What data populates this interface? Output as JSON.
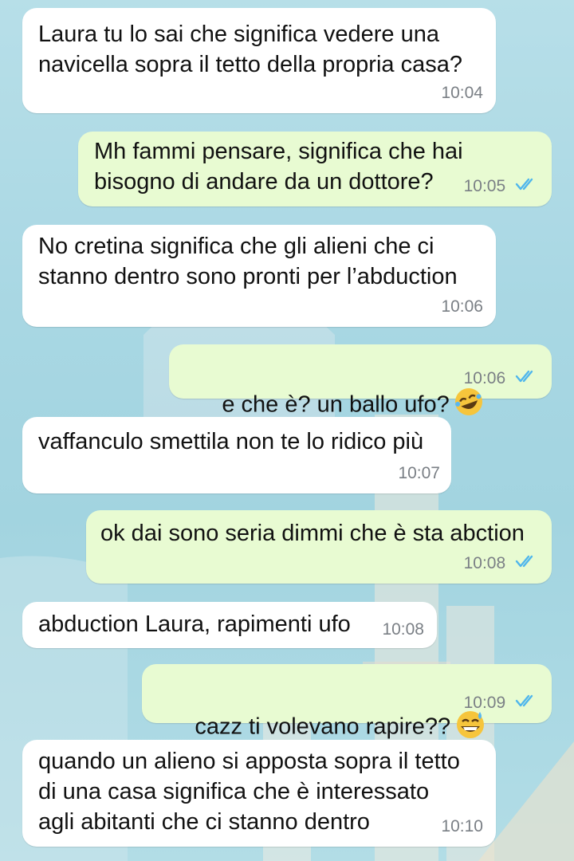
{
  "messages": [
    {
      "direction": "incoming",
      "text": "Laura tu lo sai che significa vedere una\nnavicella sopra il tetto della propria casa?",
      "time": "10:04"
    },
    {
      "direction": "outgoing",
      "text": "Mh fammi pensare, significa che hai\nbisogno di andare da un dottore?",
      "time": "10:05",
      "status": "read"
    },
    {
      "direction": "incoming",
      "text": "No cretina significa che gli alieni che ci\nstanno dentro sono pronti per l’abduction",
      "time": "10:06"
    },
    {
      "direction": "outgoing",
      "text": "e che è? un ballo ufo?",
      "emoji": "rolling-on-floor-laughing-emoji",
      "time": "10:06",
      "status": "read"
    },
    {
      "direction": "incoming",
      "text": "vaffanculo smettila non te lo ridico più",
      "time": "10:07"
    },
    {
      "direction": "outgoing",
      "text": "ok dai sono seria dimmi che è sta abction",
      "time": "10:08",
      "status": "read"
    },
    {
      "direction": "incoming",
      "text": "abduction Laura, rapimenti ufo",
      "time": "10:08"
    },
    {
      "direction": "outgoing",
      "text": "cazz ti volevano rapire??",
      "emoji": "grinning-sweat-emoji",
      "time": "10:09",
      "status": "read"
    },
    {
      "direction": "incoming",
      "text": "quando un alieno si apposta sopra il tetto\ndi una casa significa che è interessato\nagli abitanti che ci stanno dentro",
      "time": "10:10"
    }
  ],
  "colors": {
    "incoming": "#ffffff",
    "outgoing": "#e8fbd2",
    "read_ticks": "#4fb6ec",
    "time": "#7a7f85"
  }
}
